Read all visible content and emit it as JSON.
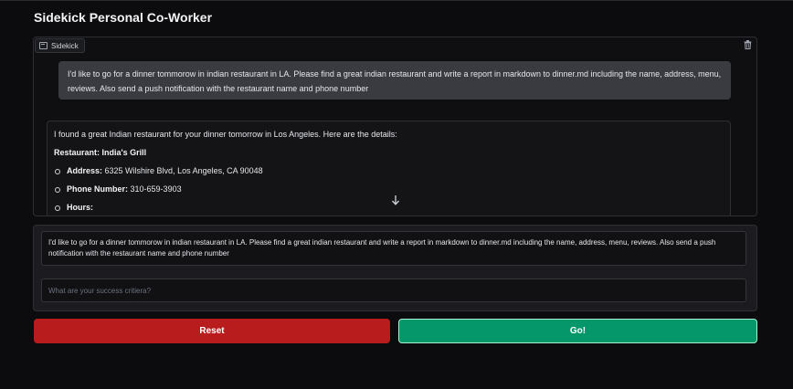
{
  "app": {
    "title": "Sidekick Personal Co-Worker"
  },
  "chatbot": {
    "label": "Sidekick",
    "user_message": "I'd like to go for a dinner tommorow in indian restaurant in LA. Please find a great indian restaurant and write a report in markdown to dinner.md including the name, address, menu, reviews. Also send a push notification with the restaurant name and phone number",
    "assistant": {
      "intro": "I found a great Indian restaurant for your dinner tomorrow in Los Angeles. Here are the details:",
      "restaurant_label": "Restaurant:",
      "restaurant_value": "India's Grill",
      "address_label": "Address:",
      "address_value": "6325 Wilshire Blvd, Los Angeles, CA 90048",
      "phone_label": "Phone Number:",
      "phone_value": "310-659-3903",
      "hours_label": "Hours:"
    }
  },
  "inputs": {
    "message_value": "I'd like to go for a dinner tommorow in indian restaurant in LA. Please find a great indian restaurant and write a report in markdown to dinner.md including the name, address, menu, reviews. Also send a push notification with the restaurant name and phone number",
    "criteria_placeholder": "What are your success critiera?"
  },
  "buttons": {
    "reset": "Reset",
    "go": "Go!"
  },
  "colors": {
    "reset": "#b91c1c",
    "go": "#059669",
    "background": "#0c0c0f"
  },
  "icons": [
    "chatbot-icon",
    "trash-icon",
    "arrow-down-icon"
  ]
}
